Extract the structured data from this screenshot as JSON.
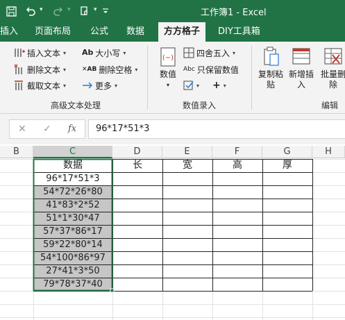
{
  "titlebar": {
    "title": "工作簿1  -  Excel",
    "icons": [
      "save-icon",
      "undo-icon",
      "redo-icon",
      "touch-mode-icon",
      "customize-toolbar-icon"
    ]
  },
  "menu": {
    "tabs": [
      "插入",
      "页面布局",
      "公式",
      "数据",
      "方方格子",
      "DIY工具箱"
    ],
    "active": "方方格子"
  },
  "ribbon": {
    "text_group": {
      "label": "高级文本处理",
      "insert_text": "插入文本",
      "delete_text": "删除文本",
      "extract_text": "截取文本",
      "case": "大小写",
      "delete_space": "删除空格",
      "more": "更多"
    },
    "entry_group": {
      "label": "数值录入",
      "number": "数值",
      "round": "四舍五入",
      "keep_number": "只保留数值"
    },
    "edit_group": {
      "label": "编辑",
      "copy_paste": "复制粘\n贴",
      "add_insert": "新增插\n入",
      "batch_delete": "批量删\n除"
    }
  },
  "formula_bar": {
    "cancel": "✕",
    "confirm": "✓",
    "fx": "fx",
    "value": "96*17*51*3"
  },
  "sheet": {
    "columns": [
      "B",
      "C",
      "D",
      "E",
      "F",
      "G",
      "H"
    ],
    "selected_column": "C",
    "header_row": [
      "数据",
      "长",
      "宽",
      "高",
      "厚"
    ],
    "data_column": [
      "96*17*51*3",
      "54*72*26*80",
      "41*83*2*52",
      "51*1*30*47",
      "57*37*86*17",
      "59*22*80*14",
      "54*100*86*97",
      "27*41*3*50",
      "79*78*37*40"
    ]
  },
  "colors": {
    "accent": "#217346",
    "ribbon_bg": "#f3f3f3",
    "selection_fill": "#c6c6c6"
  }
}
